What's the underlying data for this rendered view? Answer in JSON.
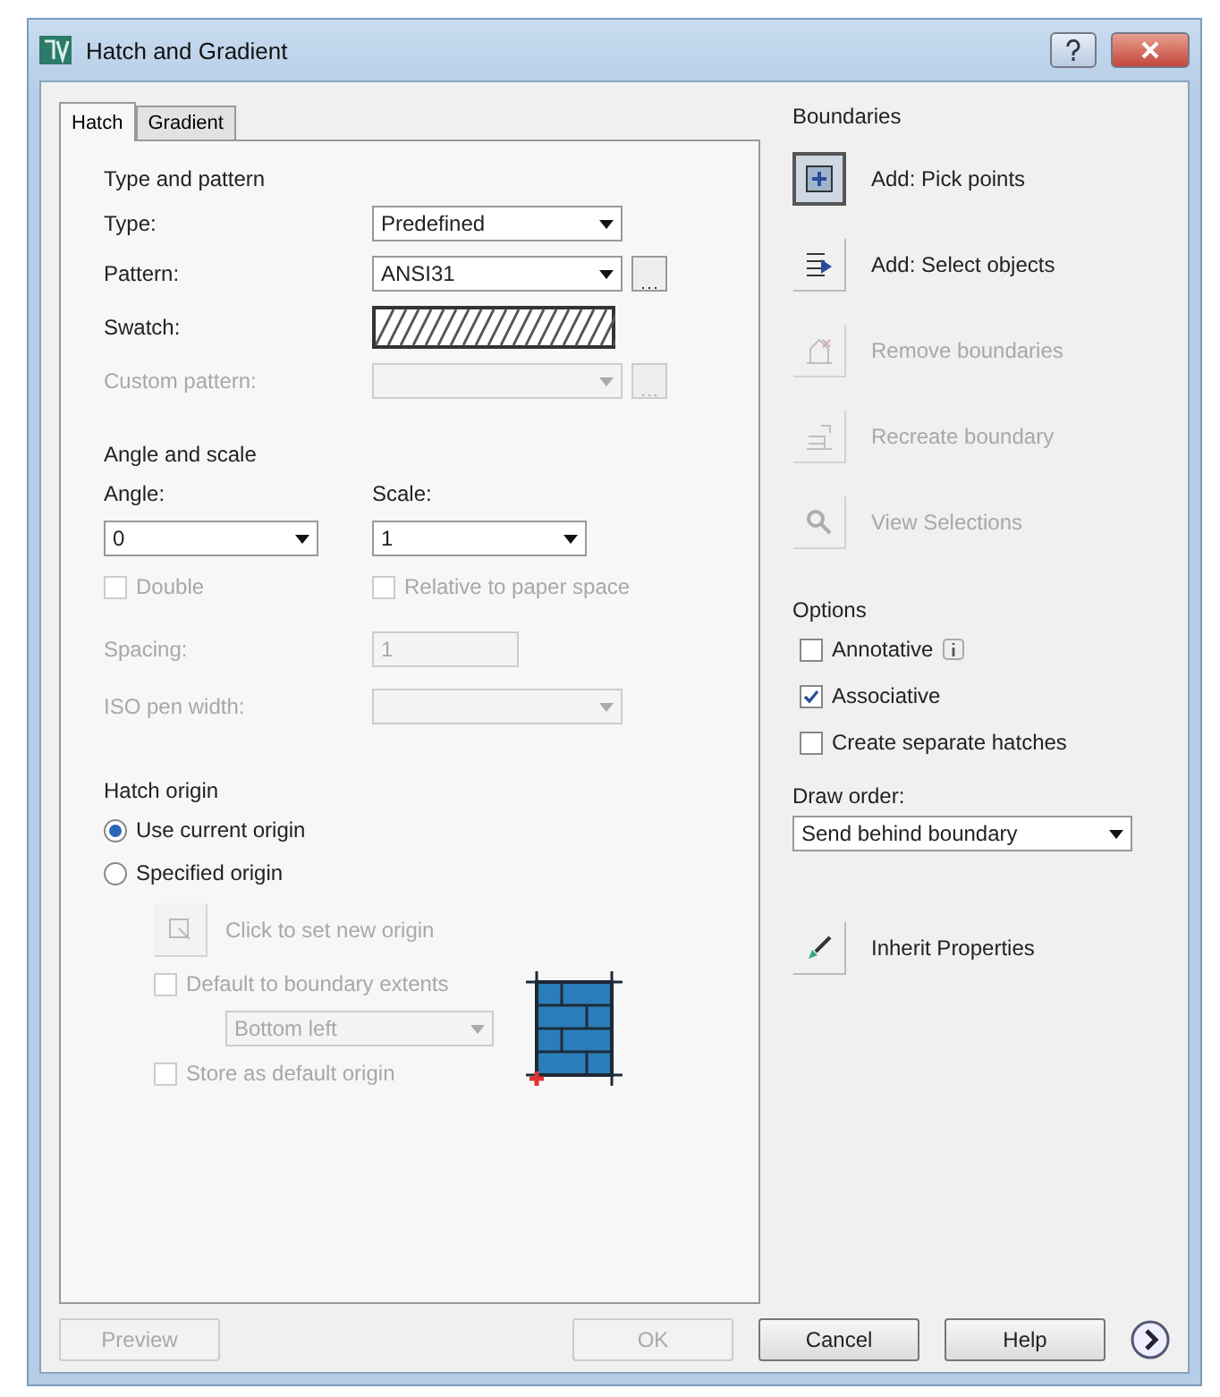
{
  "window": {
    "title": "Hatch and Gradient"
  },
  "tabs": [
    {
      "label": "Hatch",
      "selected": true
    },
    {
      "label": "Gradient",
      "selected": false
    }
  ],
  "type_and_pattern": {
    "heading": "Type and pattern",
    "fields": [
      {
        "kind": "dropdown",
        "label": "Type:",
        "value": "Predefined",
        "disabled": false
      },
      {
        "kind": "browse",
        "label": "Pattern:",
        "value": "ANSI31",
        "disabled": false
      },
      {
        "kind": "swatch",
        "label": "Swatch:"
      },
      {
        "kind": "browse",
        "label": "Custom pattern:",
        "disabled": true
      }
    ]
  },
  "angle_and_scale": {
    "heading": "Angle and scale",
    "angle": {
      "label": "Angle:",
      "value": "0"
    },
    "scale": {
      "label": "Scale:",
      "value": "1"
    },
    "checkboxes": [
      {
        "label": "Double",
        "checked": false,
        "disabled": true
      },
      {
        "label": "Relative to paper space",
        "checked": false,
        "disabled": true
      }
    ],
    "spacing": {
      "label": "Spacing:",
      "value": "1",
      "disabled": true
    },
    "iso_pen_width": {
      "label": "ISO pen width:",
      "disabled": true
    }
  },
  "hatch_origin": {
    "heading": "Hatch origin",
    "radios": [
      {
        "label": "Use current origin",
        "selected": true
      },
      {
        "label": "Specified origin",
        "selected": false
      }
    ],
    "set_origin": {
      "label": "Click to set new origin",
      "disabled": true
    },
    "default_extents": {
      "label": "Default to boundary extents",
      "checked": false,
      "disabled": true
    },
    "position": {
      "value": "Bottom left",
      "disabled": true
    },
    "store_default": {
      "label": "Store as default origin",
      "checked": false,
      "disabled": true
    }
  },
  "boundaries": {
    "heading": "Boundaries",
    "buttons": [
      {
        "kind": "pick",
        "label": "Add: Pick points",
        "disabled": false,
        "pressed": true
      },
      {
        "kind": "select",
        "label": "Add: Select objects",
        "disabled": false,
        "pressed": false
      },
      {
        "kind": "remove",
        "label": "Remove boundaries",
        "disabled": true,
        "pressed": false
      },
      {
        "kind": "recreate",
        "label": "Recreate boundary",
        "disabled": true,
        "pressed": false
      },
      {
        "kind": "view",
        "label": "View Selections",
        "disabled": true,
        "pressed": false
      }
    ]
  },
  "options": {
    "heading": "Options",
    "checkboxes": [
      {
        "kind": "info",
        "label": "Annotative",
        "checked": false
      },
      {
        "kind": "plain",
        "label": "Associative",
        "checked": true
      },
      {
        "kind": "plain",
        "label": "Create separate hatches",
        "checked": false
      }
    ],
    "draw_order": {
      "label": "Draw order:",
      "value": "Send behind boundary"
    },
    "inherit": {
      "label": "Inherit Properties"
    }
  },
  "footer": {
    "buttons": [
      {
        "label": "Preview",
        "disabled": true
      },
      {
        "label": "OK",
        "disabled": true
      },
      {
        "label": "Cancel",
        "disabled": false
      },
      {
        "label": "Help",
        "disabled": false
      }
    ]
  }
}
